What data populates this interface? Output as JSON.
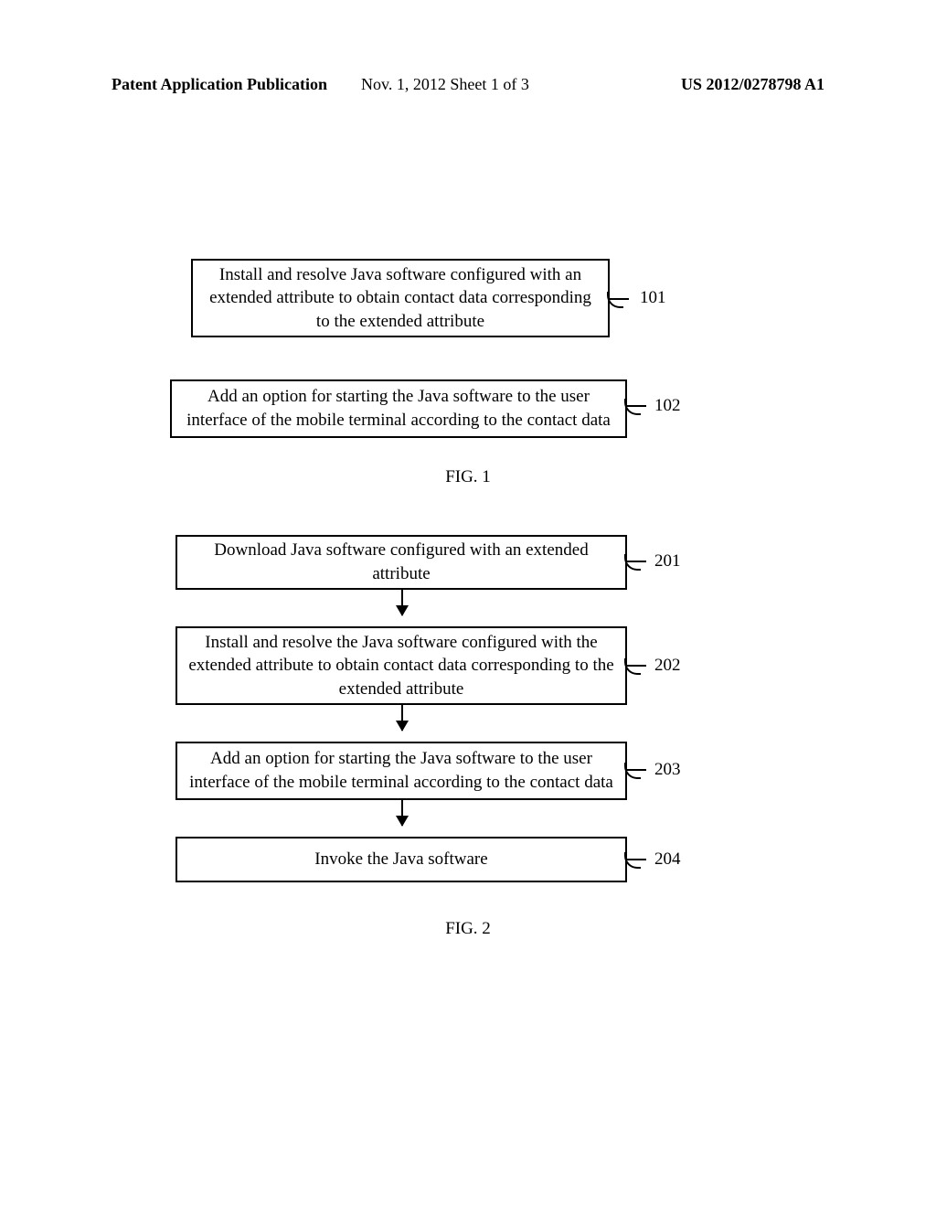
{
  "header": {
    "left": "Patent Application Publication",
    "center": "Nov. 1, 2012  Sheet 1 of 3",
    "right": "US 2012/0278798 A1"
  },
  "fig1": {
    "box101": "Install and resolve Java software configured with an extended attribute to obtain contact data corresponding to the extended attribute",
    "label101": "101",
    "box102": "Add an option for starting the Java software to the user interface of the mobile terminal according to the contact data",
    "label102": "102",
    "caption": "FIG. 1"
  },
  "fig2": {
    "box201": "Download Java software configured with an extended attribute",
    "label201": "201",
    "box202": "Install and resolve the Java software configured with the extended attribute to obtain contact data corresponding to the extended attribute",
    "label202": "202",
    "box203": "Add an option for starting the Java software to the user interface of the mobile terminal according to the contact data",
    "label203": "203",
    "box204": "Invoke the Java software",
    "label204": "204",
    "caption": "FIG. 2"
  }
}
